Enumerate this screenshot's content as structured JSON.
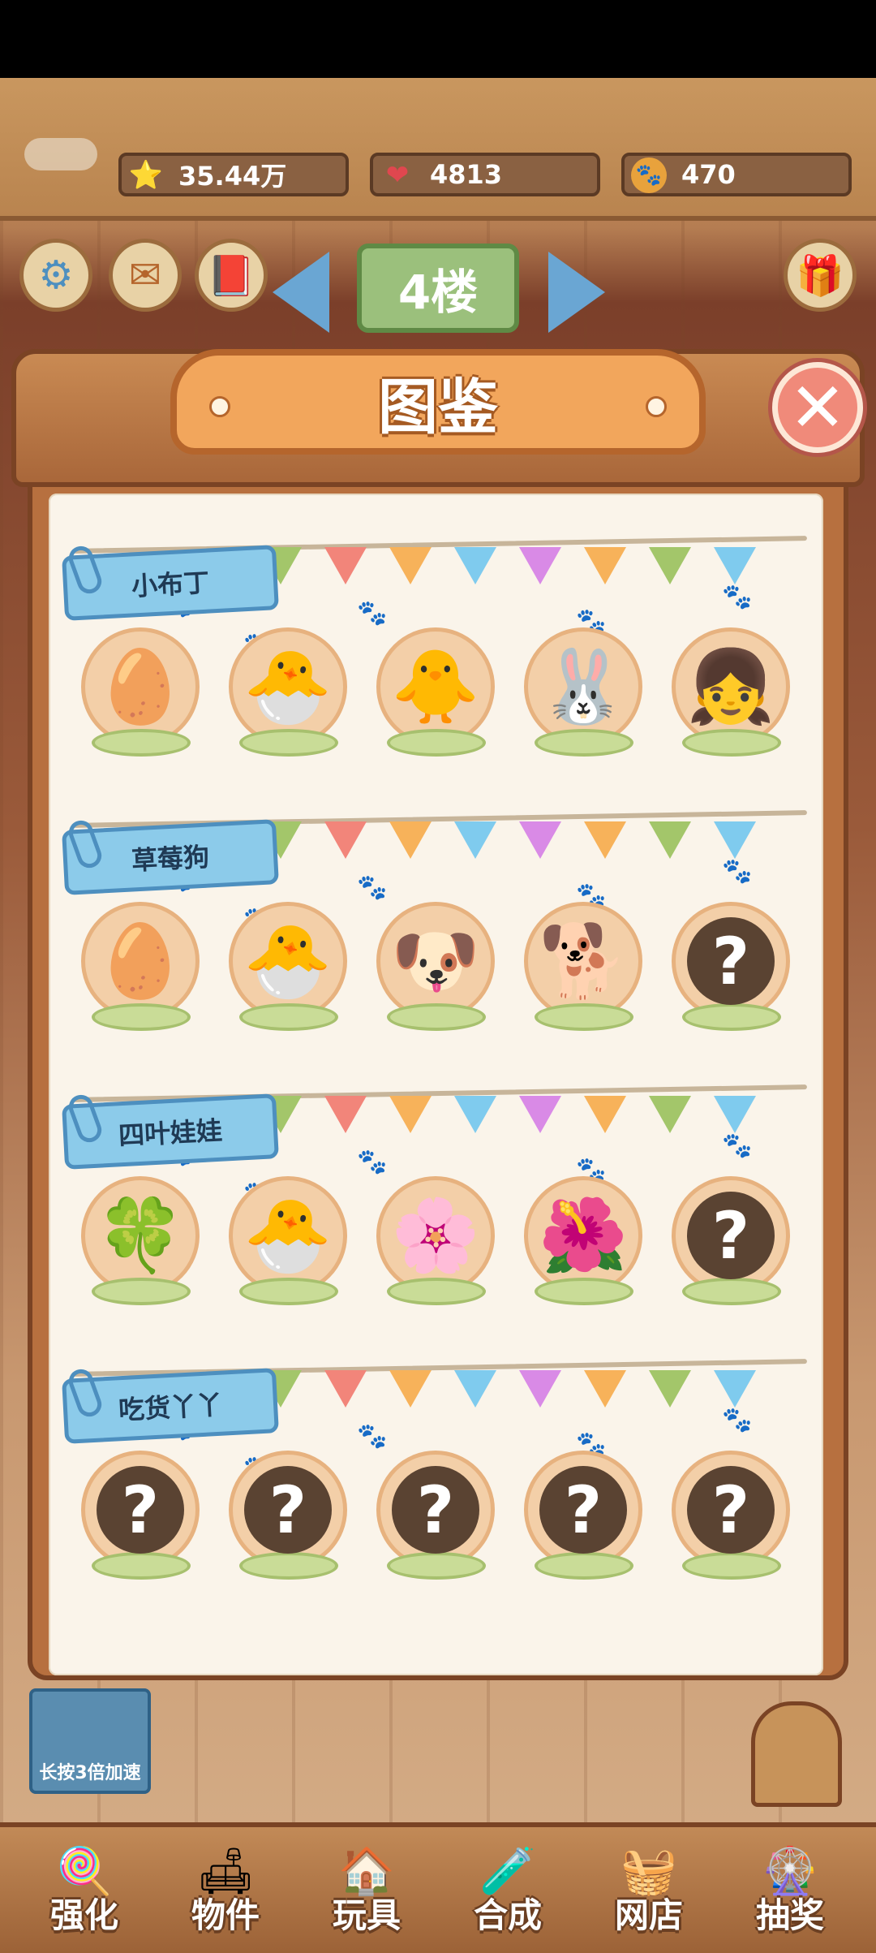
{
  "resources": {
    "stars": "35.44万",
    "hearts": "4813",
    "coins": "470"
  },
  "floor": {
    "label": "4楼"
  },
  "modal": {
    "title": "图鉴",
    "close_glyph": "✕"
  },
  "sections": [
    {
      "name": "小布丁",
      "slots": [
        "🥚",
        "🐣",
        "🐥",
        "🐰",
        "👧"
      ]
    },
    {
      "name": "草莓狗",
      "slots": [
        "🥚",
        "🐣",
        "🐶",
        "🐕",
        "?"
      ]
    },
    {
      "name": "四叶娃娃",
      "slots": [
        "🍀",
        "🐣",
        "🌸",
        "🌺",
        "?"
      ]
    },
    {
      "name": "吃货丫丫",
      "slots": [
        "?",
        "?",
        "?",
        "?",
        "?"
      ]
    }
  ],
  "speed_label": "长按3倍加速",
  "nav": [
    "强化",
    "物件",
    "玩具",
    "合成",
    "网店",
    "抽奖"
  ],
  "icons": {
    "star": "⭐",
    "heart": "❤",
    "coin": "🐾",
    "settings": "⚙",
    "mail": "✉",
    "book": "📕",
    "gift": "🎁",
    "nav_icons": [
      "🍭",
      "🛋",
      "🏠",
      "🧪",
      "🧺",
      "🎡"
    ]
  },
  "colors": {
    "flags": [
      "#a3c66a",
      "#f2857a",
      "#f7b25a",
      "#7fcbee",
      "#d98ae6",
      "#f7b25a",
      "#a3c66a",
      "#7fcbee"
    ]
  }
}
